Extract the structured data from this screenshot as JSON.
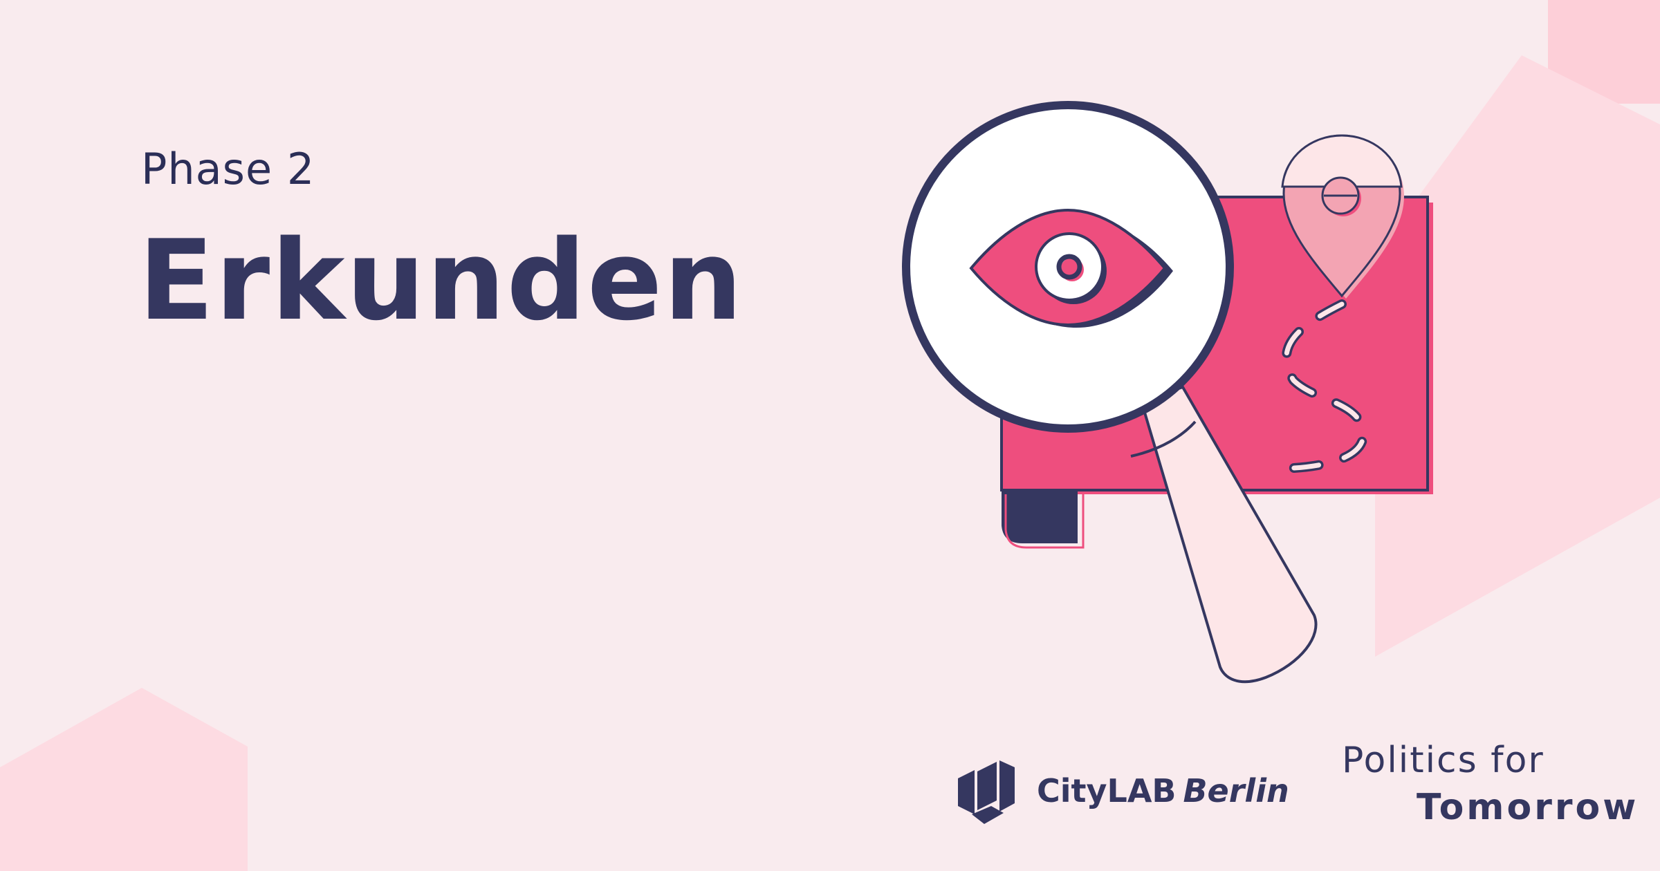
{
  "header": {
    "phase_label": "Phase 2",
    "title": "Erkunden"
  },
  "illustration": {
    "icons": [
      "magnifier-icon",
      "eye-icon",
      "map-icon",
      "location-pin-icon",
      "dashed-path"
    ]
  },
  "logos": {
    "citylab": {
      "icon": "citylab-cube-icon",
      "name": "CityLAB",
      "city": "Berlin"
    },
    "politics_for_tomorrow": {
      "line1": "Politics for",
      "line2": "Tomorrow"
    }
  },
  "colors": {
    "background": "#f9ebee",
    "shape_pink": "#fddbe2",
    "navy": "#353760",
    "accent_pink": "#ee4e7e",
    "pin_pink": "#f3a4b3",
    "handle": "#fde6e8"
  }
}
